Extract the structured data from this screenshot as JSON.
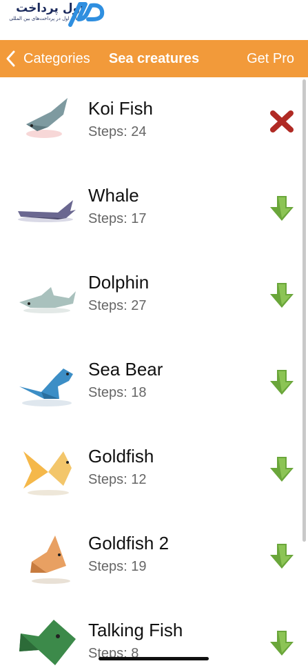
{
  "brand": {
    "title": "اول پرداخت",
    "subtitle": "انتخاب اول در پرداخت‌های بین المللی"
  },
  "navbar": {
    "back_label": "Categories",
    "title": "Sea creatures",
    "pro_label": "Get Pro",
    "color": "#f29a3a"
  },
  "items": [
    {
      "name": "Koi Fish",
      "steps": "Steps: 24",
      "action_icon": "delete-icon"
    },
    {
      "name": "Whale",
      "steps": "Steps: 17",
      "action_icon": "download-arrow-icon"
    },
    {
      "name": "Dolphin",
      "steps": "Steps: 27",
      "action_icon": "download-arrow-icon"
    },
    {
      "name": "Sea Bear",
      "steps": "Steps: 18",
      "action_icon": "download-arrow-icon"
    },
    {
      "name": "Goldfish",
      "steps": "Steps: 12",
      "action_icon": "download-arrow-icon"
    },
    {
      "name": "Goldfish 2",
      "steps": "Steps: 19",
      "action_icon": "download-arrow-icon"
    },
    {
      "name": "Talking Fish",
      "steps": "Steps: 8",
      "action_icon": "download-arrow-icon"
    }
  ]
}
